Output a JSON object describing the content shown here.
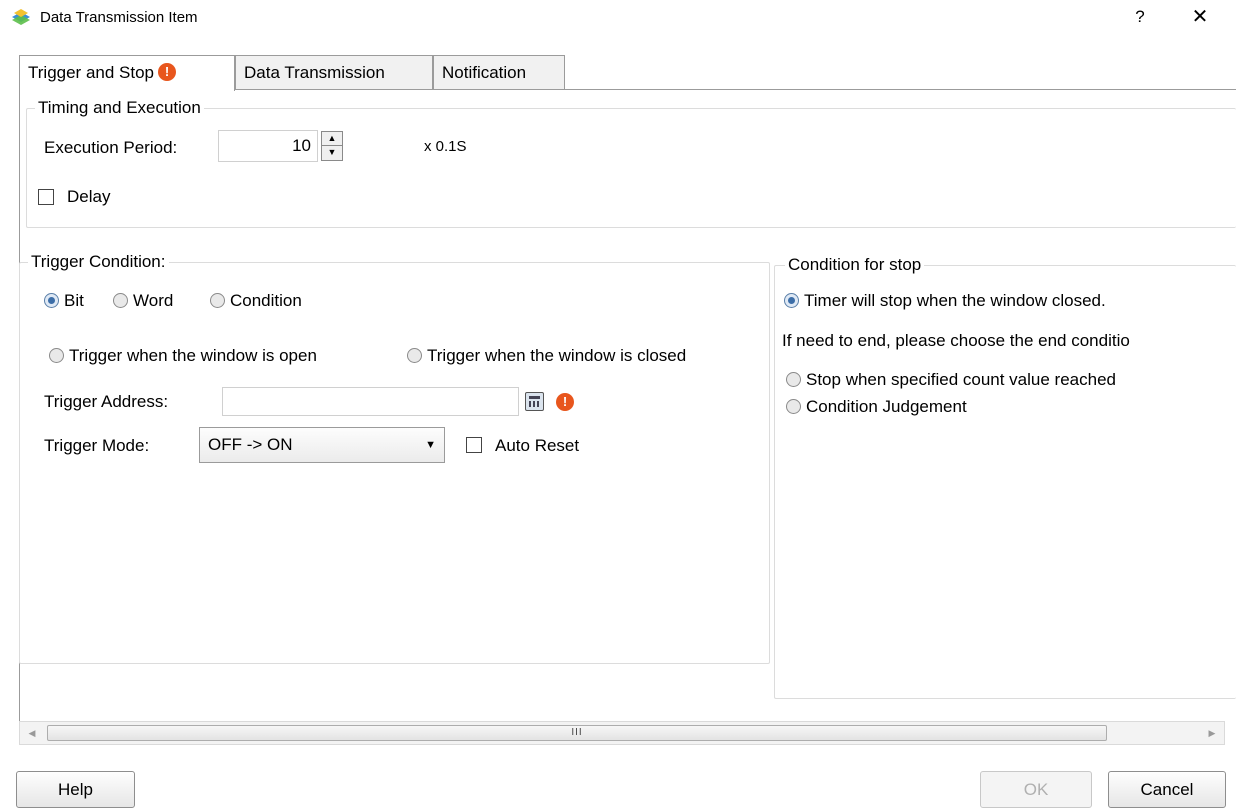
{
  "window": {
    "title": "Data Transmission Item",
    "help_glyph": "?",
    "close_glyph": "✕"
  },
  "tabs": [
    {
      "label": "Trigger and Stop",
      "active": true,
      "has_warning": true
    },
    {
      "label": "Data Transmission",
      "active": false
    },
    {
      "label": "Notification",
      "active": false
    }
  ],
  "timing": {
    "legend": "Timing and Execution",
    "period_label": "Execution Period:",
    "period_value": "10",
    "period_unit": "x 0.1S",
    "delay_label": "Delay",
    "delay_checked": false
  },
  "trigger": {
    "legend": "Trigger Condition:",
    "type_options": [
      "Bit",
      "Word",
      "Condition"
    ],
    "type_selected": "Bit",
    "window_options": [
      "Trigger when the window is open",
      "Trigger when the window is closed"
    ],
    "address_label": "Trigger Address:",
    "address_value": "",
    "mode_label": "Trigger Mode:",
    "mode_value": "OFF -> ON",
    "auto_reset_label": "Auto Reset",
    "auto_reset_checked": false
  },
  "stop": {
    "legend": "Condition for stop",
    "timer_option": "Timer will stop when the window closed.",
    "hint": "If need to end, please choose the end conditio",
    "count_option": "Stop when specified count value reached",
    "judgement_option": "Condition Judgement"
  },
  "scrollbar": {
    "grip": "III"
  },
  "buttons": {
    "help": "Help",
    "ok": "OK",
    "cancel": "Cancel"
  },
  "icons": {
    "warning": "warning-icon",
    "address_picker": "calculator-icon",
    "app": "app-icon"
  },
  "colors": {
    "warning": "#e8561d",
    "radio_checked": "#3c6ea8",
    "border": "#9b9b9b"
  }
}
